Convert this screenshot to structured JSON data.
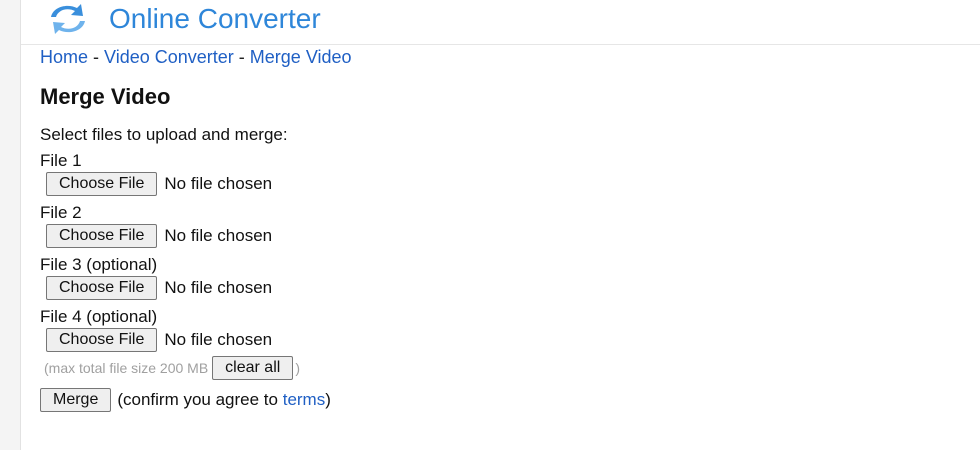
{
  "header": {
    "title": "Online Converter",
    "logo_icon": "refresh-arrows-icon",
    "accent_color": "#2e86d9"
  },
  "breadcrumb": {
    "items": [
      "Home",
      "Video Converter",
      "Merge Video"
    ],
    "separator": "-"
  },
  "page_title": "Merge Video",
  "form": {
    "intro": "Select files to upload and merge:",
    "files": [
      {
        "label": "File 1",
        "button": "Choose File",
        "status": "No file chosen"
      },
      {
        "label": "File 2",
        "button": "Choose File",
        "status": "No file chosen"
      },
      {
        "label": "File 3 (optional)",
        "button": "Choose File",
        "status": "No file chosen"
      },
      {
        "label": "File 4 (optional)",
        "button": "Choose File",
        "status": "No file chosen"
      }
    ],
    "max_size_prefix": "(max total file size 200 MB",
    "clear_all_label": "clear all",
    "max_size_suffix": ")",
    "merge_label": "Merge",
    "confirm_prefix": "(confirm you agree to ",
    "terms_label": "terms",
    "confirm_suffix": ")"
  }
}
